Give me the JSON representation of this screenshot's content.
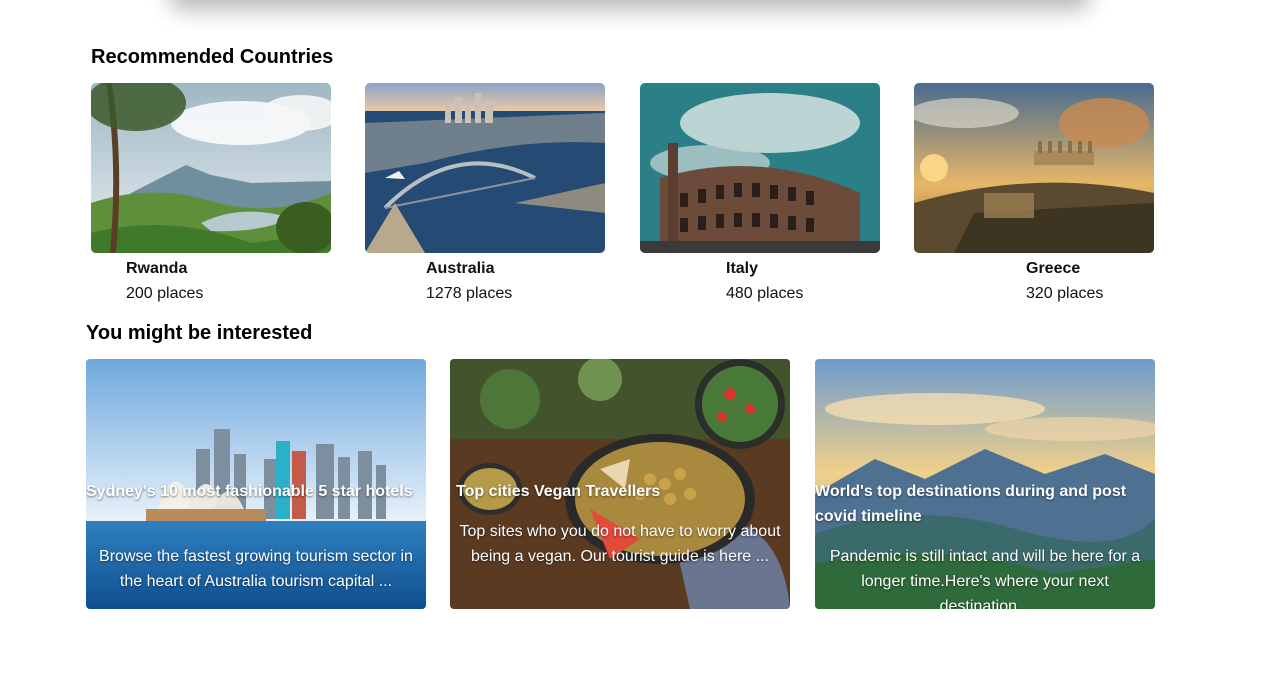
{
  "recommended": {
    "title": "Recommended Countries",
    "countries": [
      {
        "name": "Rwanda",
        "places": "200 places",
        "image": "rwanda-landscape-photo"
      },
      {
        "name": "Australia",
        "places": "1278 places",
        "image": "sydney-harbour-photo"
      },
      {
        "name": "Italy",
        "places": "480 places",
        "image": "colosseum-photo"
      },
      {
        "name": "Greece",
        "places": "320 places",
        "image": "acropolis-photo"
      }
    ]
  },
  "interested": {
    "title": "You might be interested",
    "cards": [
      {
        "title": "Sydney's 10 most fashionable 5 star hotels",
        "description": "Browse the fastest growing tourism sector in the heart of Australia tourism capital ...",
        "image": "sydney-skyline-photo"
      },
      {
        "title": "Top cities Vegan Travellers",
        "description": "Top sites who you do not have to worry about being a vegan. Our tourist guide is here ...",
        "image": "vegan-food-photo"
      },
      {
        "title": "World's top destinations during and post covid timeline",
        "description": "Pandemic is still intact and will be here for a longer time.Here's where your next destination...",
        "image": "mountain-sunset-photo"
      }
    ]
  }
}
